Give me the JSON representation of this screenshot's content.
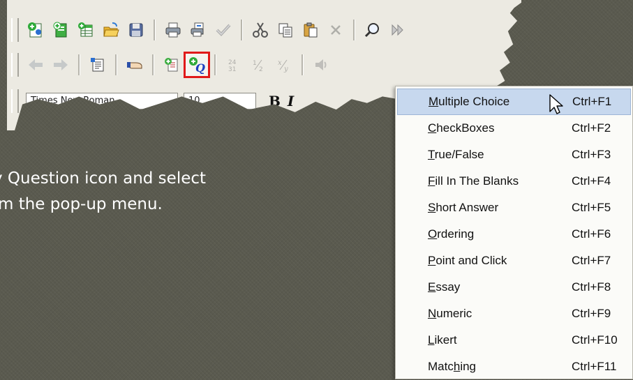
{
  "toolbar": {
    "font_name": "Times New Roman",
    "font_size": "10",
    "bold_label": "B",
    "italic_label": "I",
    "row1_icons": [
      "new-green-icon",
      "new-page-green-icon",
      "new-table-icon",
      "open-folder-icon",
      "save-disk-icon",
      "print-icon",
      "print-preview-icon",
      "spell-check-icon",
      "cut-icon",
      "copy-icon",
      "paste-icon",
      "delete-icon",
      "find-icon",
      "next-icon"
    ],
    "row2_icons": [
      "back-arrow-icon",
      "forward-arrow-icon",
      "properties-icon",
      "hand-pointer-icon",
      "add-page-icon",
      "add-question-icon",
      "sort-icon",
      "fraction-icon",
      "x-over-y-icon",
      "speaker-icon"
    ]
  },
  "instruction": {
    "line1": "y Question icon and select",
    "line2": "m the pop-up menu."
  },
  "menu": {
    "items": [
      {
        "pre": "",
        "u": "M",
        "post": "ultiple Choice",
        "shortcut": "Ctrl+F1",
        "selected": true
      },
      {
        "pre": "",
        "u": "C",
        "post": "heckBoxes",
        "shortcut": "Ctrl+F2"
      },
      {
        "pre": "",
        "u": "T",
        "post": "rue/False",
        "shortcut": "Ctrl+F3"
      },
      {
        "pre": "",
        "u": "F",
        "post": "ill In The Blanks",
        "shortcut": "Ctrl+F4"
      },
      {
        "pre": "",
        "u": "S",
        "post": "hort Answer",
        "shortcut": "Ctrl+F5"
      },
      {
        "pre": "",
        "u": "O",
        "post": "rdering",
        "shortcut": "Ctrl+F6"
      },
      {
        "pre": "",
        "u": "P",
        "post": "oint and Click",
        "shortcut": "Ctrl+F7"
      },
      {
        "pre": "",
        "u": "E",
        "post": "ssay",
        "shortcut": "Ctrl+F8"
      },
      {
        "pre": "",
        "u": "N",
        "post": "umeric",
        "shortcut": "Ctrl+F9"
      },
      {
        "pre": "",
        "u": "L",
        "post": "ikert",
        "shortcut": "Ctrl+F10"
      },
      {
        "pre": "Matc",
        "u": "h",
        "post": "ing",
        "shortcut": "Ctrl+F11"
      }
    ]
  },
  "colors": {
    "background": "#5a5a4f",
    "highlight_outline": "#e0191a",
    "menu_selection": "#c7d8ee"
  }
}
